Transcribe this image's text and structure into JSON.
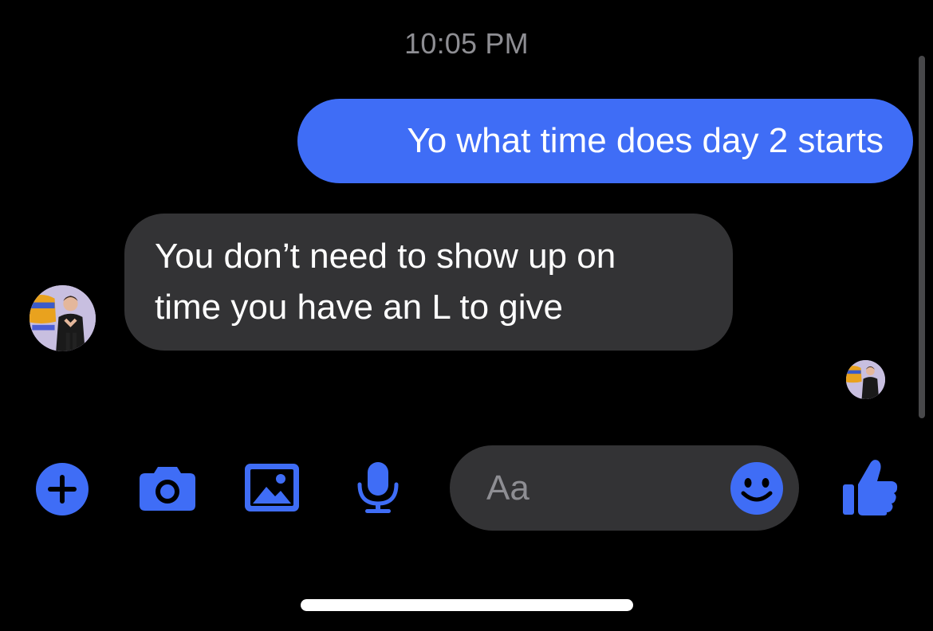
{
  "thread": {
    "timestamp": "10:05 PM",
    "messages": [
      {
        "direction": "outgoing",
        "lines": [
          "Yo what time does day 2 starts"
        ]
      },
      {
        "direction": "incoming",
        "lines": [
          "You don’t need to show up on",
          "time you have an L to give"
        ]
      }
    ]
  },
  "composer": {
    "placeholder": "Aa"
  },
  "toolbar": {
    "icons": [
      "plus-icon",
      "camera-icon",
      "gallery-icon",
      "microphone-icon",
      "emoji-icon",
      "thumbs-up-icon"
    ]
  },
  "colors": {
    "accent": "#3f6df6",
    "outgoing_bubble": "#3f6df6",
    "incoming_bubble": "#333335",
    "background": "#000000",
    "timestamp_text": "#8e8e93"
  }
}
